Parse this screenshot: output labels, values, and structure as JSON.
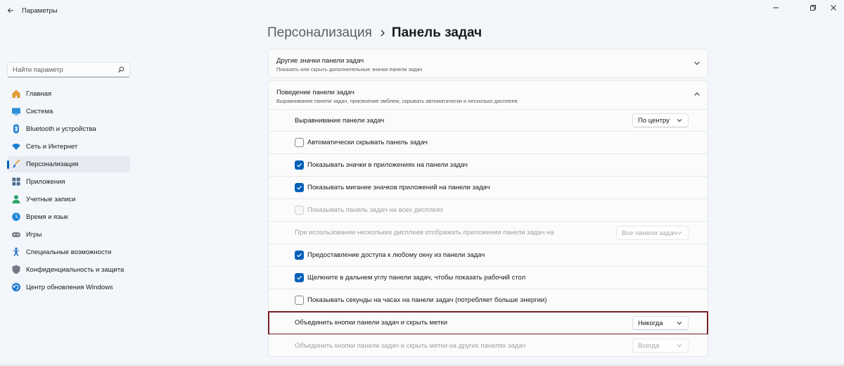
{
  "window": {
    "title": "Параметры"
  },
  "search": {
    "placeholder": "Найти параметр"
  },
  "nav": {
    "items": [
      {
        "label": "Главная",
        "icon": "home-icon"
      },
      {
        "label": "Система",
        "icon": "monitor-icon"
      },
      {
        "label": "Bluetooth и устройства",
        "icon": "bluetooth-icon"
      },
      {
        "label": "Сеть и Интернет",
        "icon": "wifi-icon"
      },
      {
        "label": "Персонализация",
        "icon": "brush-icon",
        "active": true
      },
      {
        "label": "Приложения",
        "icon": "apps-icon"
      },
      {
        "label": "Учетные записи",
        "icon": "person-icon"
      },
      {
        "label": "Время и язык",
        "icon": "globe-clock-icon"
      },
      {
        "label": "Игры",
        "icon": "gamepad-icon"
      },
      {
        "label": "Специальные возможности",
        "icon": "accessibility-icon"
      },
      {
        "label": "Конфиденциальность и защита",
        "icon": "shield-icon"
      },
      {
        "label": "Центр обновления Windows",
        "icon": "update-icon"
      }
    ]
  },
  "breadcrumb": {
    "parent": "Персонализация",
    "current": "Панель задач"
  },
  "other_icons": {
    "title": "Другие значки панели задач",
    "desc": "Показать или скрыть дополнительные значки панели задач"
  },
  "behavior": {
    "title": "Поведение панели задач",
    "desc": "Выравнивание панели задач, присвоение эмблем, скрывать автоматически и несколько дисплеев",
    "alignment": {
      "label": "Выравнивание панели задач",
      "value": "По центру"
    },
    "autohide": {
      "label": "Автоматически скрывать панель задач",
      "checked": false
    },
    "show_badges": {
      "label": "Показывать значки в приложениях на панели задач",
      "checked": true
    },
    "show_flashing": {
      "label": "Показывать мигание значков приложений на панели задач",
      "checked": true
    },
    "all_displays": {
      "label": "Показывать панель задач на всех дисплеях",
      "checked": false,
      "disabled": true
    },
    "multi_display": {
      "label": "При использовании нескольких дисплеев отображать приложения панели задач на",
      "value": "Все панели задач",
      "disabled": true
    },
    "share_window": {
      "label": "Предоставление доступа к любому окну из панели задач",
      "checked": true
    },
    "corner_desktop": {
      "label": "Щелкните в дальнем углу панели задач, чтобы показать рабочий стол",
      "checked": true
    },
    "show_seconds": {
      "label": "Показывать секунды на часах на панели задач (потребляет больше энергии)",
      "checked": false
    },
    "combine": {
      "label": "Объединить кнопки панели задач и скрыть метки",
      "value": "Никогда"
    },
    "combine_other": {
      "label": "Объединить кнопки панели задач и скрыть метки на других панелях задач",
      "value": "Всегда",
      "disabled": true
    }
  }
}
